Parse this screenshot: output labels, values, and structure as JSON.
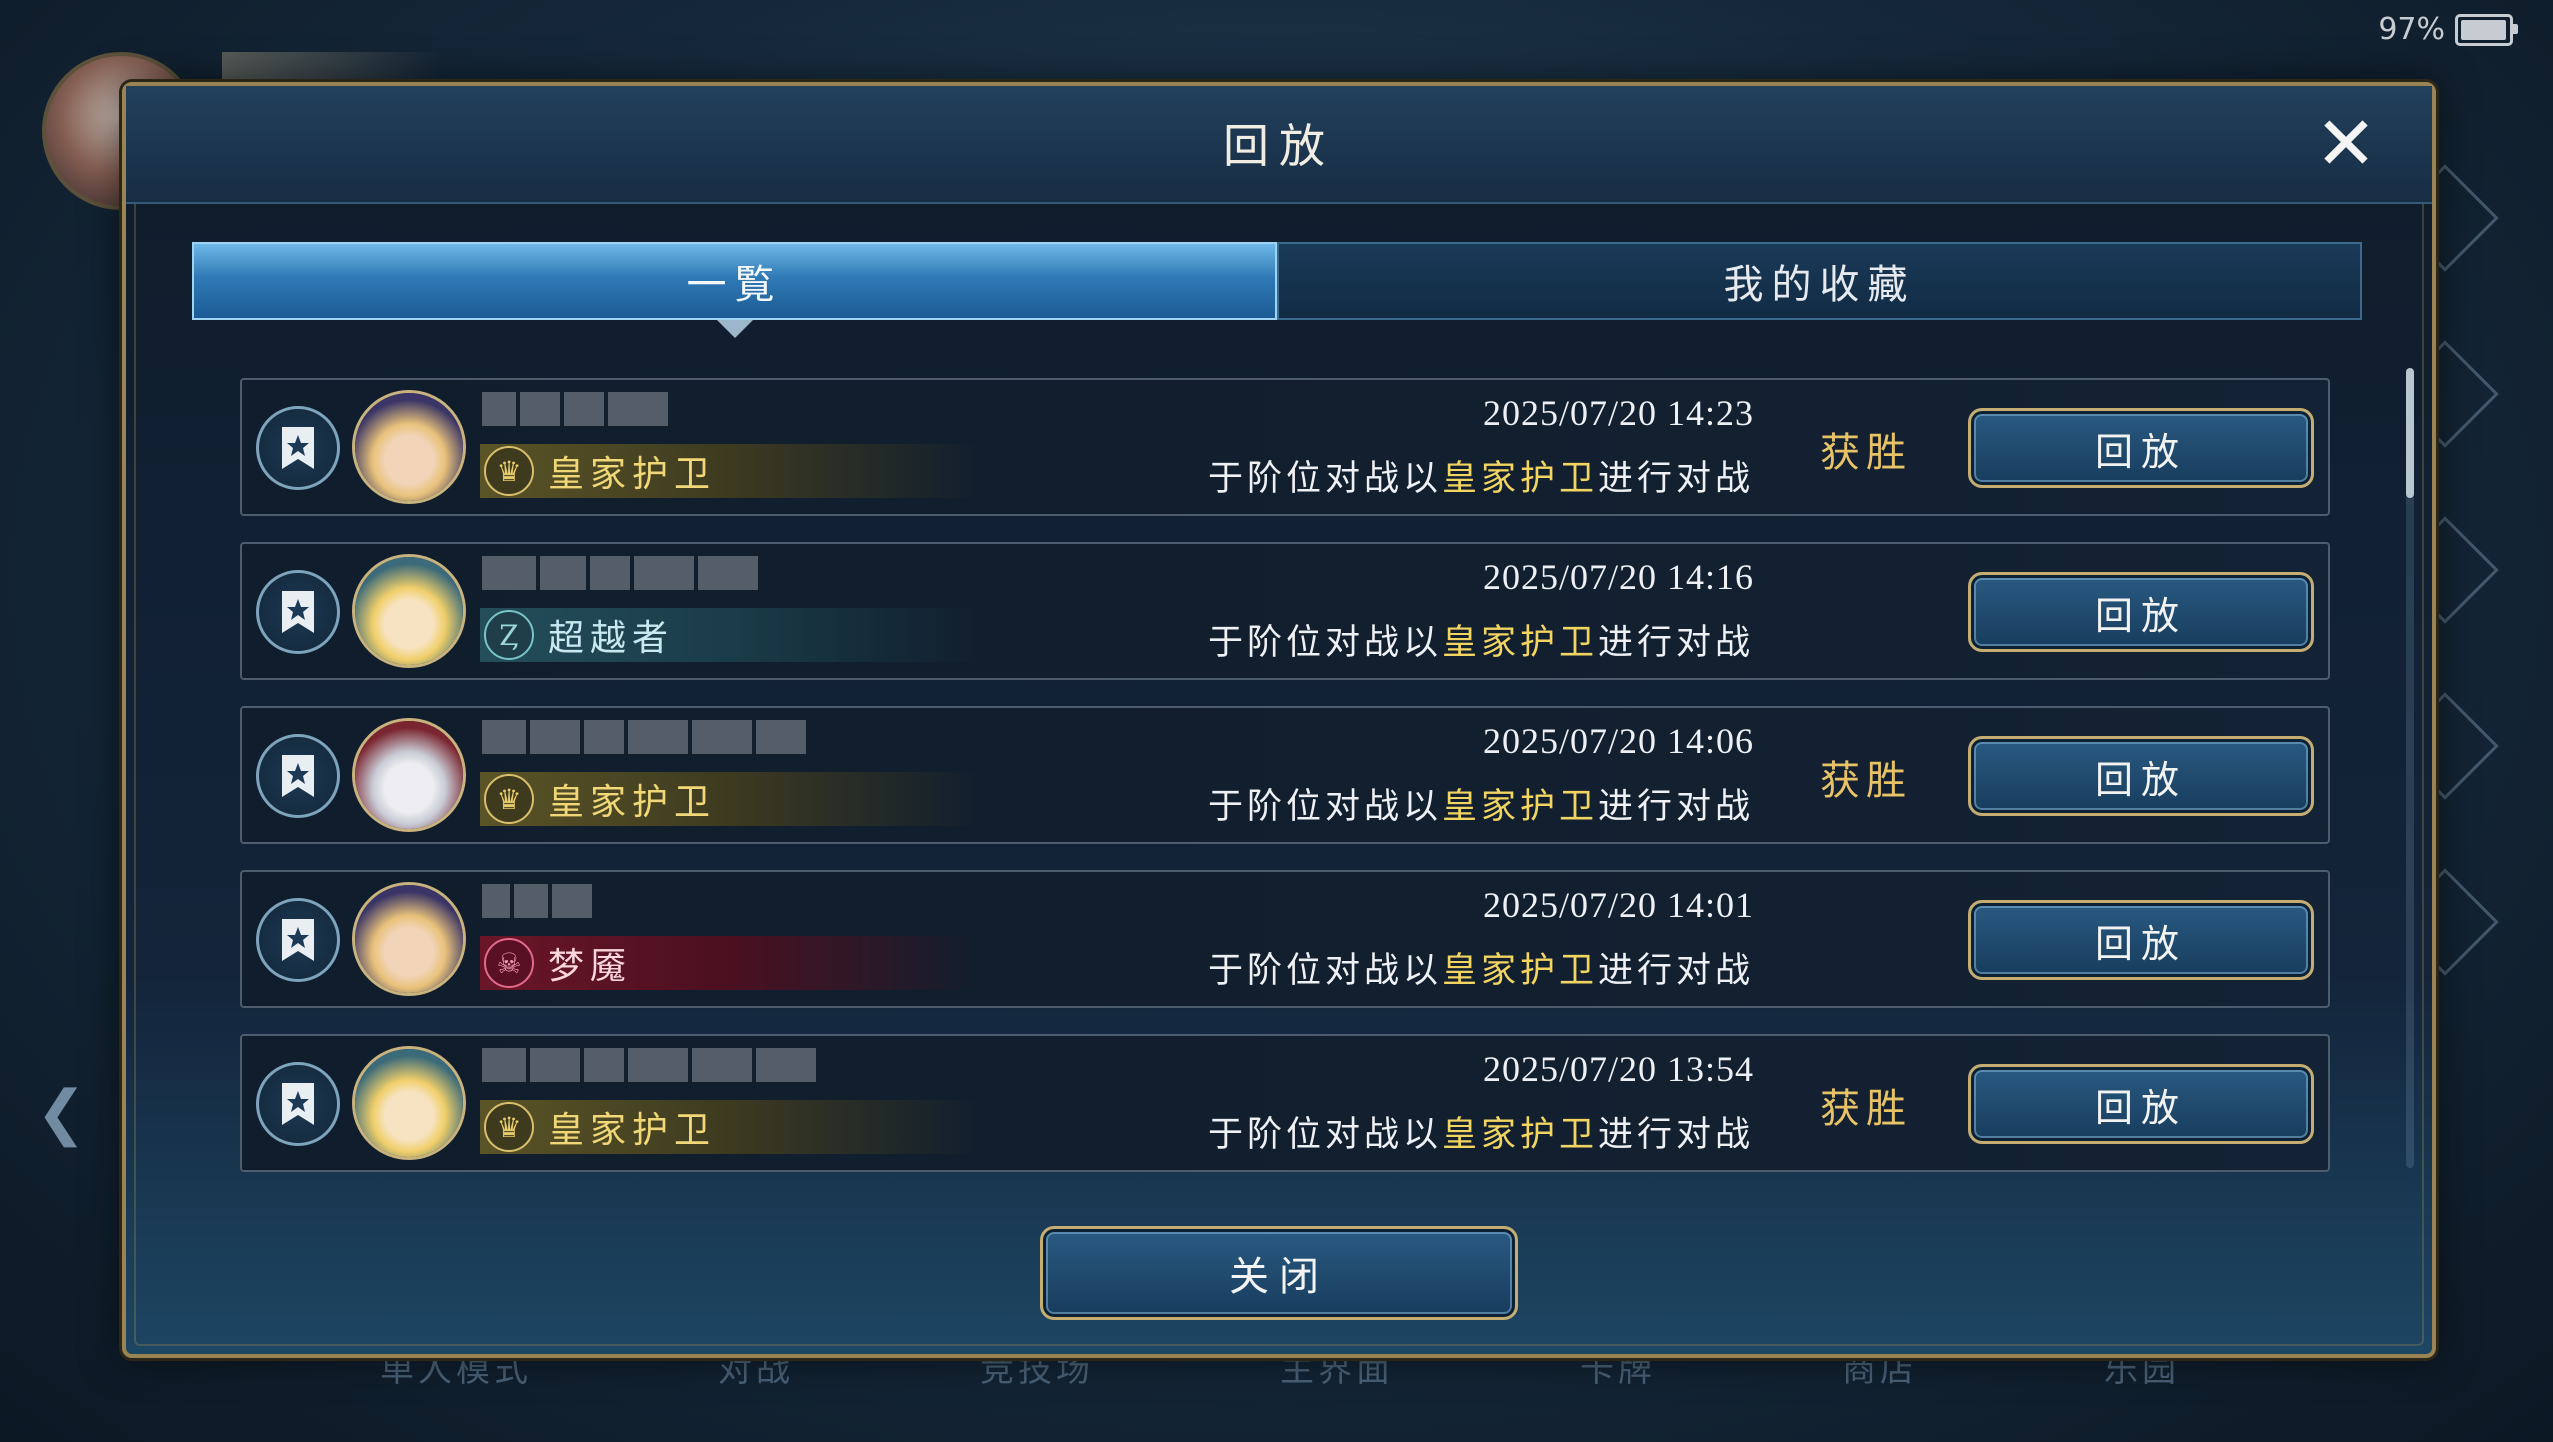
{
  "status_bar": {
    "battery_percent": "97%",
    "battery_level": 0.97
  },
  "background": {
    "nav_items": [
      "单人模式",
      "对战",
      "竞技场",
      "主界面",
      "卡牌",
      "商店",
      "乐园"
    ]
  },
  "dialog": {
    "title": "回放",
    "tabs": [
      {
        "label": "一覧",
        "active": true
      },
      {
        "label": "我的收藏",
        "active": false
      }
    ],
    "close_label": "关闭",
    "rows": [
      {
        "datetime": "2025/07/20  14:23",
        "desc_pre": "于阶位对战以",
        "desc_class": "皇家护卫",
        "desc_post": "进行对战",
        "opp_class": "皇家护卫",
        "opp_class_icon": "crown-icon",
        "opp_style": "royal",
        "result": "获胜",
        "button": "回放",
        "avatar_colors": [
          "#3a3566",
          "#f2d4b8",
          "#e8c27a"
        ]
      },
      {
        "datetime": "2025/07/20  14:16",
        "desc_pre": "于阶位对战以",
        "desc_class": "皇家护卫",
        "desc_post": "进行对战",
        "opp_class": "超越者",
        "opp_class_icon": "transcendent-icon",
        "opp_style": "trans",
        "result": "",
        "button": "回放",
        "avatar_colors": [
          "#3b6a7a",
          "#f7e3c2",
          "#f0cf6a"
        ]
      },
      {
        "datetime": "2025/07/20  14:06",
        "desc_pre": "于阶位对战以",
        "desc_class": "皇家护卫",
        "desc_post": "进行对战",
        "opp_class": "皇家护卫",
        "opp_class_icon": "crown-icon",
        "opp_style": "royal",
        "result": "获胜",
        "button": "回放",
        "avatar_colors": [
          "#7a2630",
          "#eeeef2",
          "#c9ccd6"
        ]
      },
      {
        "datetime": "2025/07/20  14:01",
        "desc_pre": "于阶位对战以",
        "desc_class": "皇家护卫",
        "desc_post": "进行对战",
        "opp_class": "梦魇",
        "opp_class_icon": "nightmare-icon",
        "opp_style": "night",
        "result": "",
        "button": "回放",
        "avatar_colors": [
          "#3a3566",
          "#f2d4b8",
          "#e8c27a"
        ]
      },
      {
        "datetime": "2025/07/20  13:54",
        "desc_pre": "于阶位对战以",
        "desc_class": "皇家护卫",
        "desc_post": "进行对战",
        "opp_class": "皇家护卫",
        "opp_class_icon": "crown-icon",
        "opp_style": "royal",
        "result": "获胜",
        "button": "回放",
        "avatar_colors": [
          "#3b6a7a",
          "#f7e3c2",
          "#f0cf6a"
        ]
      }
    ]
  },
  "colors": {
    "accent_gold": "#c5ad72",
    "victory": "#e7c266",
    "highlight": "#f2d461",
    "tab_active": "#2f7ab5"
  }
}
